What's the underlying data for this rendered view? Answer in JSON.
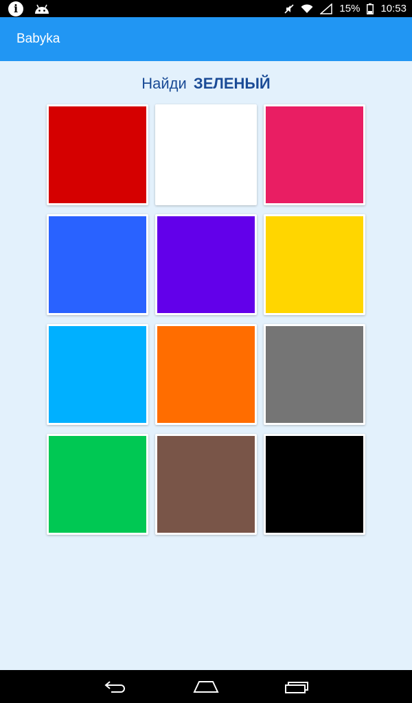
{
  "status_bar": {
    "battery": "15%",
    "time": "10:53",
    "icons": [
      "info-icon",
      "android-icon",
      "mute-icon",
      "wifi-icon",
      "signal-icon",
      "battery-icon"
    ]
  },
  "app_bar": {
    "title": "Babyka"
  },
  "prompt": {
    "lead": "Найди",
    "target": "ЗЕЛЕНЫЙ"
  },
  "colors": [
    {
      "name": "red",
      "hex": "#d50000"
    },
    {
      "name": "white",
      "hex": "#ffffff"
    },
    {
      "name": "pink",
      "hex": "#e91e63"
    },
    {
      "name": "blue",
      "hex": "#2962ff"
    },
    {
      "name": "violet",
      "hex": "#6200ea"
    },
    {
      "name": "yellow",
      "hex": "#ffd600"
    },
    {
      "name": "light-blue",
      "hex": "#00b0ff"
    },
    {
      "name": "orange",
      "hex": "#ff6d00"
    },
    {
      "name": "grey",
      "hex": "#757575"
    },
    {
      "name": "green",
      "hex": "#00c853"
    },
    {
      "name": "brown",
      "hex": "#795548"
    },
    {
      "name": "black",
      "hex": "#000000"
    }
  ],
  "nav_bar": {
    "icons": [
      "back-icon",
      "home-icon",
      "recents-icon"
    ]
  }
}
